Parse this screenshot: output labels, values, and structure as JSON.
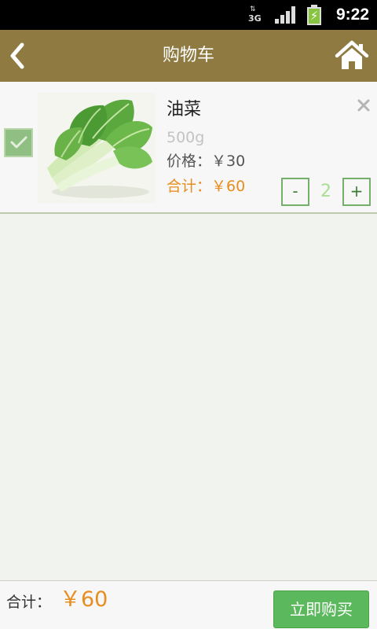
{
  "status_bar": {
    "network_label": "3G",
    "time": "9:22",
    "icons": [
      "network-3g-icon",
      "signal-icon",
      "battery-charging-icon"
    ]
  },
  "header": {
    "title": "购物车",
    "back_icon": "chevron-left-icon",
    "home_icon": "home-icon",
    "background_color": "#8f7a41"
  },
  "cart": {
    "items": [
      {
        "checked": true,
        "image": "bok-choy-photo",
        "name": "油菜",
        "weight": "500g",
        "price_label": "价格：￥30",
        "subtotal_label": "合计：￥60",
        "quantity": "2",
        "minus_label": "-",
        "plus_label": "+",
        "delete_icon": "close-icon"
      }
    ]
  },
  "footer": {
    "total_label": "合计：",
    "total_value": "￥60",
    "buy_label": "立即购买",
    "accent_color": "#e88d1f",
    "button_color": "#5cb85c"
  }
}
